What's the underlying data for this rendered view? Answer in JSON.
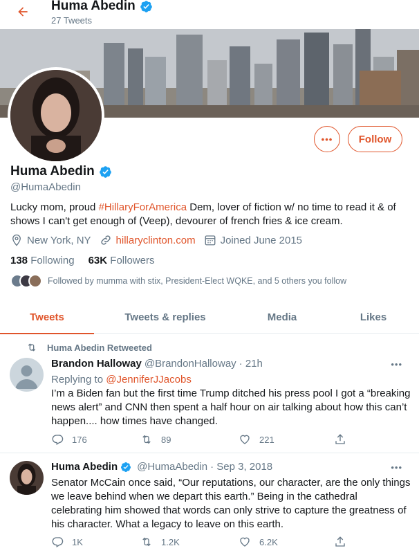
{
  "header": {
    "title": "Huma Abedin",
    "tweet_count": "27 Tweets"
  },
  "profile": {
    "name": "Huma Abedin",
    "handle": "@HumaAbedin",
    "bio_part1": "Lucky mom, proud ",
    "bio_hashtag": "#HillaryForAmerica",
    "bio_part2": " Dem, lover of fiction w/ no time to read it & of shows I can't get enough of (Veep), devourer of french fries & ice cream.",
    "location": "New York, NY",
    "website": "hillaryclinton.com",
    "joined": "Joined June 2015",
    "following_count": "138",
    "following_label": "Following",
    "followers_count": "63K",
    "followers_label": "Followers",
    "followed_by": "Followed by mumma with stix, President-Elect WQKE, and 5 others you follow",
    "more_label": "•••",
    "follow_label": "Follow"
  },
  "tabs": [
    {
      "label": "Tweets",
      "active": true
    },
    {
      "label": "Tweets & replies",
      "active": false
    },
    {
      "label": "Media",
      "active": false
    },
    {
      "label": "Likes",
      "active": false
    }
  ],
  "tweets": [
    {
      "retweeted_by": "Huma Abedin Retweeted",
      "author": "Brandon Halloway",
      "handle": "@BrandonHalloway",
      "time": "· 21h",
      "replying_label": "Replying to ",
      "replying_to": "@JenniferJJacobs",
      "text": "I’m a Biden fan but the first time Trump ditched his press pool I got a “breaking news alert” and CNN then spent a half hour on air talking about how this can’t happen.... how times have changed.",
      "replies": "176",
      "retweets": "89",
      "likes": "221",
      "more": "•••"
    },
    {
      "author": "Huma Abedin",
      "handle": "@HumaAbedin",
      "time": "· Sep 3, 2018",
      "text": "Senator McCain once said, “Our reputations, our character, are the only things we leave behind when we depart this earth.” Being in the cathedral celebrating him showed that words can only strive to capture the greatness of his character. What a legacy to leave on this earth.",
      "replies": "1K",
      "retweets": "1.2K",
      "likes": "6.2K",
      "more": "•••"
    }
  ],
  "colors": {
    "accent": "#e0552b",
    "verified": "#1da1f2",
    "secondary_text": "#657786"
  }
}
